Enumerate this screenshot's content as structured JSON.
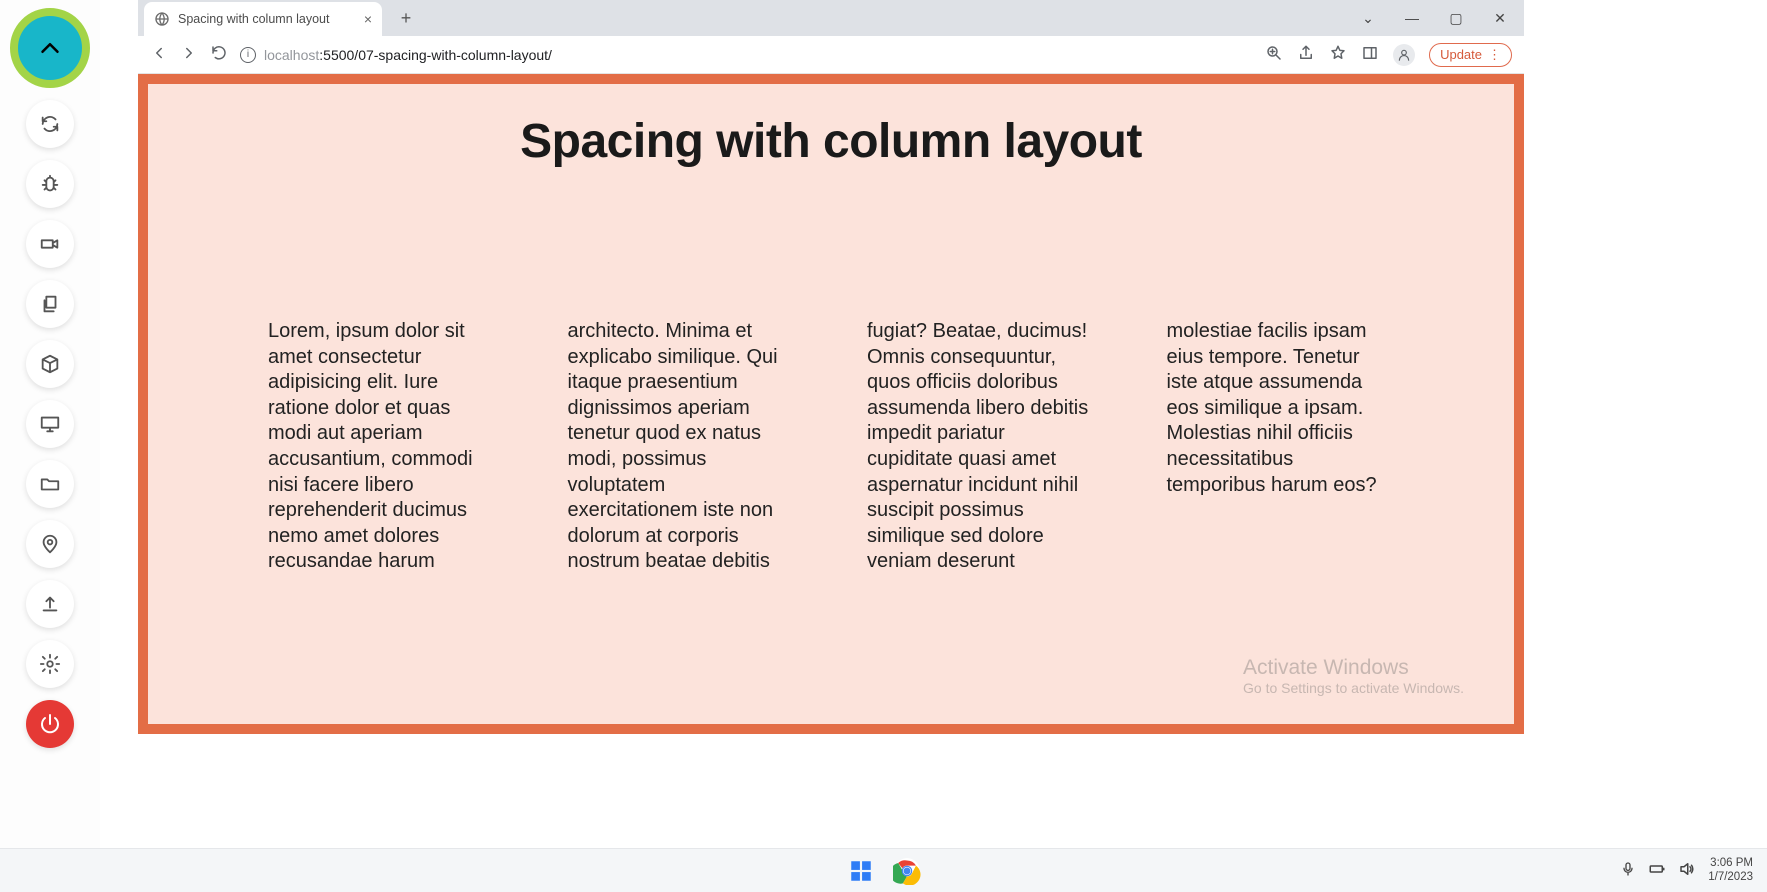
{
  "rail": {
    "toggle": "chevron-up"
  },
  "browser": {
    "tab_title": "Spacing with column layout",
    "url_faded_prefix": "localhost",
    "url_rest": ":5500/07-spacing-with-column-layout/",
    "update_label": "Update"
  },
  "page": {
    "heading": "Spacing with column layout",
    "body_text": "Lorem, ipsum dolor sit amet consectetur adipisicing elit. Iure ratione dolor et quas modi aut aperiam accusantium, commodi nisi facere libero reprehenderit ducimus nemo amet dolores recusandae harum architecto. Minima et explicabo similique. Qui itaque praesentium dignissimos aperiam tenetur quod ex natus modi, possimus voluptatem exercitationem iste non dolorum at corporis nostrum beatae debitis fugiat? Beatae, ducimus! Omnis consequuntur, quos officiis doloribus assumenda libero debitis impedit pariatur cupiditate quasi amet aspernatur incidunt nihil suscipit possimus similique sed dolore veniam deserunt molestiae facilis ipsam eius tempore. Tenetur iste atque assumenda eos similique a ipsam. Molestias nihil officiis necessitatibus temporibus harum eos?"
  },
  "watermark": {
    "line1": "Activate Windows",
    "line2": "Go to Settings to activate Windows."
  },
  "taskbar": {
    "time": "3:06 PM",
    "date": "1/7/2023"
  }
}
